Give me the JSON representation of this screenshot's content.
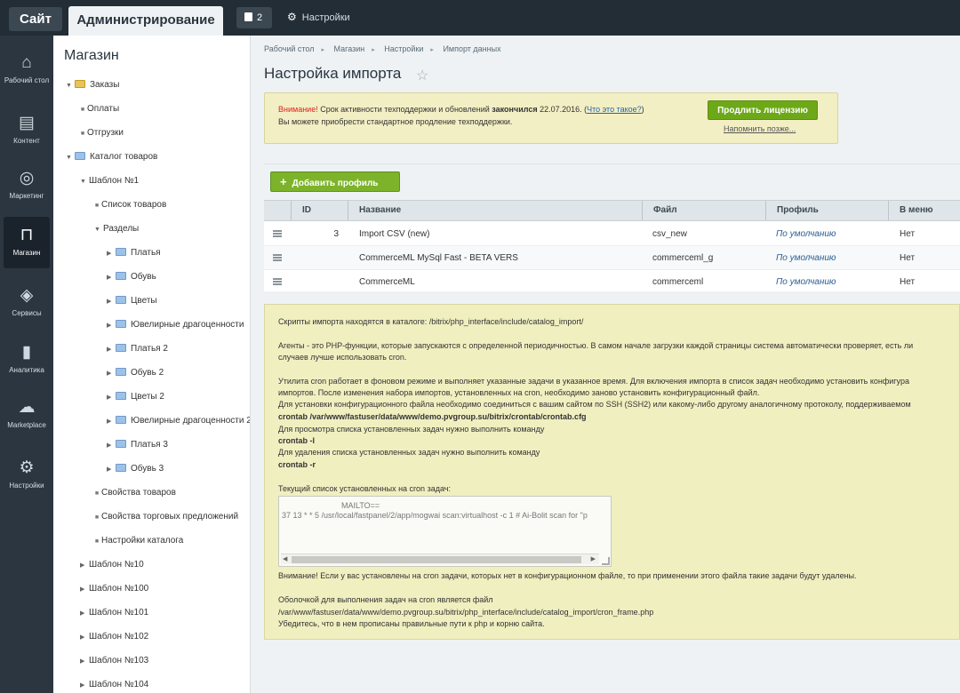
{
  "topbar": {
    "site_label": "Сайт",
    "admin_label": "Администрирование",
    "notifications_count": "2",
    "settings_label": "Настройки"
  },
  "iconnav": [
    {
      "label": "Рабочий стол",
      "icon": "home-icon",
      "glyph": "⌂"
    },
    {
      "label": "Контент",
      "icon": "document-icon",
      "glyph": "▤"
    },
    {
      "label": "Маркетинг",
      "icon": "target-icon",
      "glyph": "◎"
    },
    {
      "label": "Магазин",
      "icon": "basket-icon",
      "glyph": "⊓"
    },
    {
      "label": "Сервисы",
      "icon": "layers-icon",
      "glyph": "◈"
    },
    {
      "label": "Аналитика",
      "icon": "bar-chart-icon",
      "glyph": "▮"
    },
    {
      "label": "Marketplace",
      "icon": "cloud-download-icon",
      "glyph": "☁"
    },
    {
      "label": "Настройки",
      "icon": "gear-icon",
      "glyph": "⚙"
    }
  ],
  "tree": {
    "title": "Магазин",
    "items": [
      {
        "label": "Заказы"
      },
      {
        "label": "Оплаты"
      },
      {
        "label": "Отгрузки"
      },
      {
        "label": "Каталог товаров"
      },
      {
        "label": "Шаблон №1"
      },
      {
        "label": "Список товаров"
      },
      {
        "label": "Разделы"
      },
      {
        "label": "Платья"
      },
      {
        "label": "Обувь"
      },
      {
        "label": "Цветы"
      },
      {
        "label": "Ювелирные драгоценности"
      },
      {
        "label": "Платья 2"
      },
      {
        "label": "Обувь 2"
      },
      {
        "label": "Цветы 2"
      },
      {
        "label": "Ювелирные драгоценности 2"
      },
      {
        "label": "Платья 3"
      },
      {
        "label": "Обувь 3"
      },
      {
        "label": "Свойства товаров"
      },
      {
        "label": "Свойства торговых предложений"
      },
      {
        "label": "Настройки каталога"
      },
      {
        "label": "Шаблон №10"
      },
      {
        "label": "Шаблон №100"
      },
      {
        "label": "Шаблон №101"
      },
      {
        "label": "Шаблон №102"
      },
      {
        "label": "Шаблон №103"
      },
      {
        "label": "Шаблон №104"
      }
    ]
  },
  "breadcrumb": [
    "Рабочий стол",
    "Магазин",
    "Настройки",
    "Импорт данных"
  ],
  "page_title": "Настройка импорта",
  "license": {
    "warning": "Внимание!",
    "text1": " Срок активности техподдержки и обновлений ",
    "ended": "закончился",
    "date": " 22.07.2016. (",
    "what_link": "Что это такое?",
    "close_paren": ")",
    "text2": "Вы можете приобрести стандартное продление техподдержки.",
    "prolong_button": "Продлить лицензию",
    "remind_link": "Напомнить позже..."
  },
  "add_profile_button": "Добавить профиль",
  "table": {
    "headers": [
      "ID",
      "Название",
      "Файл",
      "Профиль",
      "В меню"
    ],
    "rows": [
      {
        "id": "3",
        "name": "Import CSV (new)",
        "file": "csv_new",
        "profile": "По умолчанию",
        "menu": "Нет"
      },
      {
        "id": "",
        "name": "CommerceML MySql Fast - BETA VERS",
        "file": "commerceml_g",
        "profile": "По умолчанию",
        "menu": "Нет"
      },
      {
        "id": "",
        "name": "CommerceML",
        "file": "commerceml",
        "profile": "По умолчанию",
        "menu": "Нет"
      }
    ]
  },
  "info": {
    "line1": "Скрипты импорта находятся в каталоге: /bitrix/php_interface/include/catalog_import/",
    "line2": "Агенты - это PHP-функции, которые запускаются с определенной периодичностью. В самом начале загрузки каждой страницы система автоматически проверяет, есть ли",
    "line3": "случаев лучше использовать cron.",
    "line4": "Утилита cron работает в фоновом режиме и выполняет указанные задачи в указанное время. Для включения импорта в список задач необходимо установить конфигура",
    "line5": "импортов. После изменения набора импортов, установленных на cron, необходимо заново установить конфигурационный файл.",
    "line6": "Для установки конфигурационного файла необходимо соединиться с вашим сайтом по SSH (SSH2) или какому-либо другому аналогичному протоколу, поддерживаемом",
    "line7": "crontab /var/www/fastuser/data/www/demo.pvgroup.su/bitrix/crontab/crontab.cfg",
    "line8": "Для просмотра списка установленных задач нужно выполнить команду",
    "line9": "crontab -l",
    "line10": "Для удаления списка установленных задач нужно выполнить команду",
    "line11": "crontab -r",
    "line12": "Текущий список установленных на cron задач:",
    "cron1": "MAILTO==",
    "cron2": "37 13 * * 5 /usr/local/fastpanel/2/app/mogwai scan:virtualhost -c 1 # Ai-Bolit scan for \"p",
    "line13": "Внимание! Если у вас установлены на cron задачи, которых нет в конфигурационном файле, то при применении этого файла такие задачи будут удалены.",
    "line14": "Оболочкой для выполнения задач на cron является файл",
    "line15": "/var/www/fastuser/data/www/demo.pvgroup.su/bitrix/php_interface/include/catalog_import/cron_frame.php",
    "line16": "Убедитесь, что в нем прописаны правильные пути к php и корню сайта."
  },
  "colors": {
    "topbar": "#232d36",
    "nav": "#2b3640",
    "accent_green": "#6da818",
    "notice_bg": "#f3efc4",
    "warning_red": "#dd2222"
  }
}
